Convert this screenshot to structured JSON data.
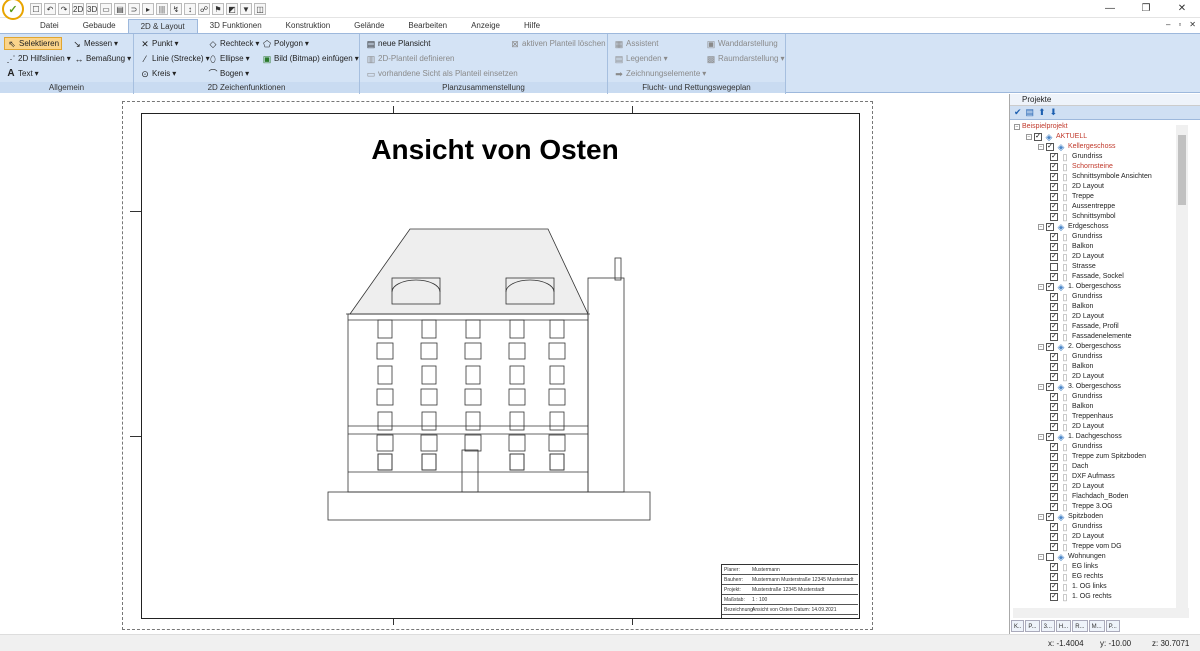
{
  "quick_access": [
    "☐",
    "↶",
    "↷",
    "2D",
    "3D",
    "▭",
    "▤",
    "⊃",
    "▸",
    "|||",
    "↯",
    "↕",
    "☍",
    "⚑",
    "◩",
    "▼",
    "◫"
  ],
  "window_controls": {
    "minimize": "—",
    "restore": "❐",
    "close": "✕"
  },
  "menu": [
    "Datei",
    "Gebaude",
    "2D & Layout",
    "3D Funktionen",
    "Konstruktion",
    "Gelände",
    "Bearbeiten",
    "Anzeige",
    "Hilfe"
  ],
  "menu_right": {
    "min": "–",
    "restore": "▫",
    "close": "✕"
  },
  "ribbon": {
    "allgemein": {
      "title": "Allgemein",
      "select": "Selektieren",
      "messen": "Messen",
      "hilfslinien": "2D Hilfslinien",
      "bemassung": "Bemaßung",
      "text": "Text"
    },
    "zeichnen": {
      "title": "2D Zeichenfunktionen",
      "punkt": "Punkt",
      "linie": "Linie (Strecke)",
      "kreis": "Kreis",
      "rechteck": "Rechteck",
      "ellipse": "Ellipse",
      "bogen": "Bogen",
      "polygon": "Polygon",
      "bitmap": "Bild (Bitmap) einfügen"
    },
    "plan": {
      "title": "Planzusammenstellung",
      "neu": "neue Plansicht",
      "definieren": "2D-Planteil definieren",
      "einsetzen": "vorhandene Sicht als Planteil einsetzen",
      "loeschen": "aktiven Planteil löschen"
    },
    "flucht": {
      "title": "Flucht- und Rettungswegeplan",
      "assistent": "Assistent",
      "legenden": "Legenden",
      "elemente": "Zeichnungselemente",
      "wand": "Wanddarstellung",
      "raum": "Raumdarstellung"
    }
  },
  "drawing": {
    "title": "Ansicht von Osten",
    "stamp": [
      {
        "k": "Planer:",
        "v": "Mustermann"
      },
      {
        "k": "Bauherr:",
        "v": "Mustermann Musterstraße 12345 Musterstadt"
      },
      {
        "k": "Projekt:",
        "v": "Musterstraße 12345 Musterstadt"
      },
      {
        "k": "Maßstab:",
        "v": "1 : 100"
      },
      {
        "k": "Bezeichnung:",
        "v": "Ansicht von Osten     Datum: 14.09.2021"
      }
    ]
  },
  "panel": {
    "title": "Projekte",
    "tree": [
      {
        "l": 0,
        "t": "Beispielprojekt",
        "red": true,
        "cb": false,
        "exp": "−"
      },
      {
        "l": 1,
        "t": "AKTUELL",
        "red": true,
        "cb": true,
        "exp": "−"
      },
      {
        "l": 2,
        "t": "Kellergeschoss",
        "red": true,
        "cb": true,
        "exp": "−"
      },
      {
        "l": 3,
        "t": "Grundriss",
        "cb": true
      },
      {
        "l": 3,
        "t": "Schornsteine",
        "red": true,
        "cb": true
      },
      {
        "l": 3,
        "t": "Schnittsymbole Ansichten",
        "cb": true
      },
      {
        "l": 3,
        "t": "2D Layout",
        "cb": true
      },
      {
        "l": 3,
        "t": "Treppe",
        "cb": true
      },
      {
        "l": 3,
        "t": "Aussentreppe",
        "cb": true
      },
      {
        "l": 3,
        "t": "Schnittsymbol",
        "cb": true
      },
      {
        "l": 2,
        "t": "Erdgeschoss",
        "cb": true,
        "exp": "−"
      },
      {
        "l": 3,
        "t": "Grundriss",
        "cb": true
      },
      {
        "l": 3,
        "t": "Balkon",
        "cb": true
      },
      {
        "l": 3,
        "t": "2D Layout",
        "cb": true
      },
      {
        "l": 3,
        "t": "Strasse",
        "cb": false
      },
      {
        "l": 3,
        "t": "Fassade, Sockel",
        "cb": true
      },
      {
        "l": 2,
        "t": "1. Obergeschoss",
        "cb": true,
        "exp": "−"
      },
      {
        "l": 3,
        "t": "Grundriss",
        "cb": true
      },
      {
        "l": 3,
        "t": "Balkon",
        "cb": true
      },
      {
        "l": 3,
        "t": "2D Layout",
        "cb": true
      },
      {
        "l": 3,
        "t": "Fassade, Profil",
        "cb": true
      },
      {
        "l": 3,
        "t": "Fassadenelemente",
        "cb": true
      },
      {
        "l": 2,
        "t": "2. Obergeschoss",
        "cb": true,
        "exp": "−"
      },
      {
        "l": 3,
        "t": "Grundriss",
        "cb": true
      },
      {
        "l": 3,
        "t": "Balkon",
        "cb": true
      },
      {
        "l": 3,
        "t": "2D Layout",
        "cb": true
      },
      {
        "l": 2,
        "t": "3. Obergeschoss",
        "cb": true,
        "exp": "−"
      },
      {
        "l": 3,
        "t": "Grundriss",
        "cb": true
      },
      {
        "l": 3,
        "t": "Balkon",
        "cb": true
      },
      {
        "l": 3,
        "t": "Treppenhaus",
        "cb": true
      },
      {
        "l": 3,
        "t": "2D Layout",
        "cb": true
      },
      {
        "l": 2,
        "t": "1. Dachgeschoss",
        "cb": true,
        "exp": "−"
      },
      {
        "l": 3,
        "t": "Grundriss",
        "cb": true
      },
      {
        "l": 3,
        "t": "Treppe zum Spitzboden",
        "cb": true
      },
      {
        "l": 3,
        "t": "Dach",
        "cb": true
      },
      {
        "l": 3,
        "t": "DXF Aufmass",
        "cb": true
      },
      {
        "l": 3,
        "t": "2D Layout",
        "cb": true
      },
      {
        "l": 3,
        "t": "Flachdach_Boden",
        "cb": true
      },
      {
        "l": 3,
        "t": "Treppe 3.OG",
        "cb": true
      },
      {
        "l": 2,
        "t": "Spitzboden",
        "cb": true,
        "exp": "−"
      },
      {
        "l": 3,
        "t": "Grundriss",
        "cb": true
      },
      {
        "l": 3,
        "t": "2D Layout",
        "cb": true
      },
      {
        "l": 3,
        "t": "Treppe vom DG",
        "cb": true
      },
      {
        "l": 2,
        "t": "Wohnungen",
        "cb": false,
        "exp": "−"
      },
      {
        "l": 3,
        "t": "EG links",
        "cb": true
      },
      {
        "l": 3,
        "t": "EG rechts",
        "cb": true
      },
      {
        "l": 3,
        "t": "1. OG links",
        "cb": true
      },
      {
        "l": 3,
        "t": "1. OG rechts",
        "cb": true
      }
    ],
    "tabs": [
      "K..",
      "P...",
      "3...",
      "H...",
      "R...",
      "M...",
      "P..."
    ]
  },
  "status": {
    "x": "x: -1.4004",
    "y": "y: -10.00",
    "z": "z: 30.7071"
  },
  "colors": {
    "ribbon": "#d4e3f5",
    "accent": "#1d5fb0",
    "selected": "#fbd48a"
  }
}
